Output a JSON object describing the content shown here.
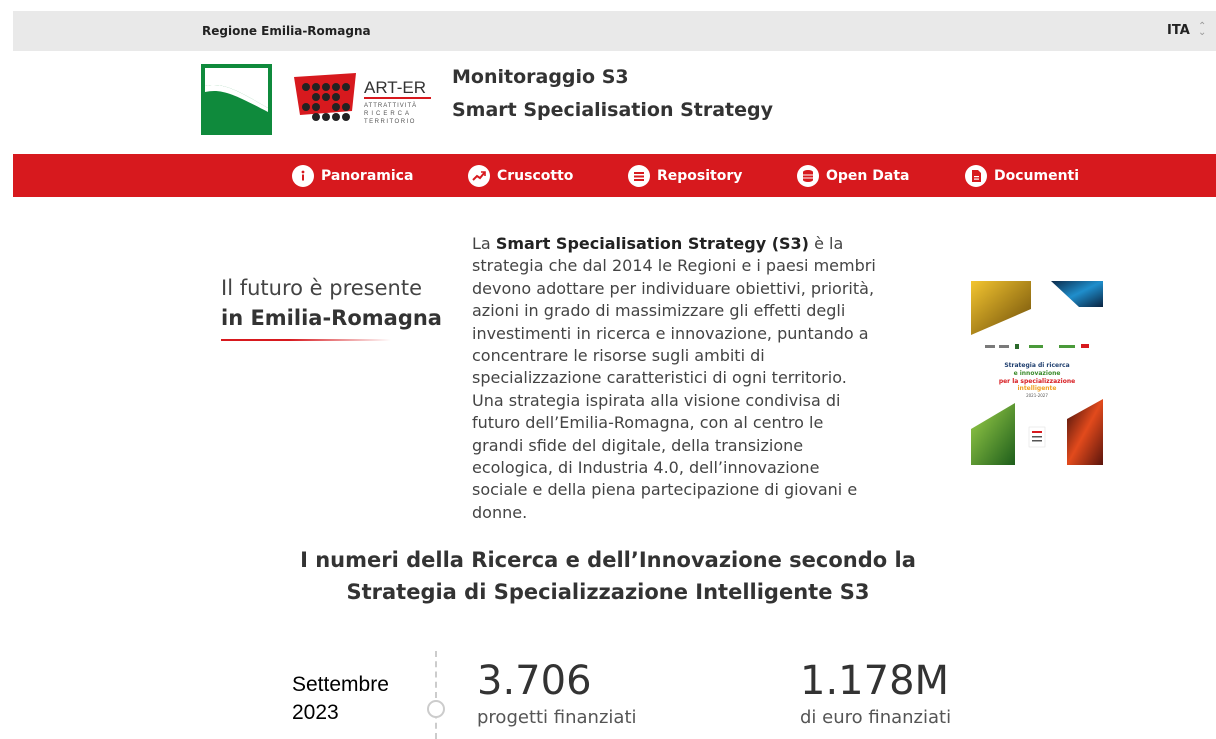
{
  "topbar": {
    "region": "Regione Emilia-Romagna",
    "language": "ITA"
  },
  "header": {
    "arter_name": "ART-ER",
    "arter_tagline": [
      "ATTRATTIVITÀ",
      "RICERCA",
      "TERRITORIO"
    ],
    "title_line1": "Monitoraggio S3",
    "title_line2": "Smart Specialisation Strategy"
  },
  "nav": {
    "items": [
      {
        "label": "Panoramica",
        "icon": "info-icon"
      },
      {
        "label": "Cruscotto",
        "icon": "trend-icon"
      },
      {
        "label": "Repository",
        "icon": "list-icon"
      },
      {
        "label": "Open Data",
        "icon": "database-icon"
      },
      {
        "label": "Documenti",
        "icon": "document-icon"
      }
    ]
  },
  "hero": {
    "tagline_line1": "Il futuro è presente",
    "tagline_line2": "in Emilia-Romagna",
    "desc_prefix": "La ",
    "desc_bold": "Smart Specialisation Strategy (S3)",
    "desc_rest": " è la strategia che dal 2014 le Regioni e i paesi membri devono adottare per individuare obiettivi, priorità, azioni in grado di massimizzare gli effetti degli investimenti in ricerca e innovazione, puntando a concentrare le risorse sugli ambiti di specializzazione caratteristici di ogni territorio. Una strategia ispirata alla visione condivisa di futuro dell’Emilia-Romagna, con al centro le grandi sfide del digitale, della transizione ecologica, di Industria 4.0, dell’innovazione sociale e della piena partecipazione di giovani e donne.",
    "cover": {
      "title_lines": [
        "Strategia di ricerca",
        "e innovazione",
        "per la specializzazione",
        "intelligente",
        "2021-2027"
      ]
    }
  },
  "numbers": {
    "title_line1": "I numeri della Ricerca e dell’Innovazione secondo la",
    "title_line2": "Strategia di Specializzazione Intelligente S3",
    "date_line1": "Settembre",
    "date_line2": "2023",
    "kpis": [
      {
        "value": "3.706",
        "label": "progetti finanziati"
      },
      {
        "value": "1.178M",
        "label": "di euro finanziati"
      }
    ]
  },
  "colors": {
    "brand_red": "#d7191e",
    "brand_green": "#0f8a3c",
    "topbar_bg": "#e9e9e9"
  }
}
